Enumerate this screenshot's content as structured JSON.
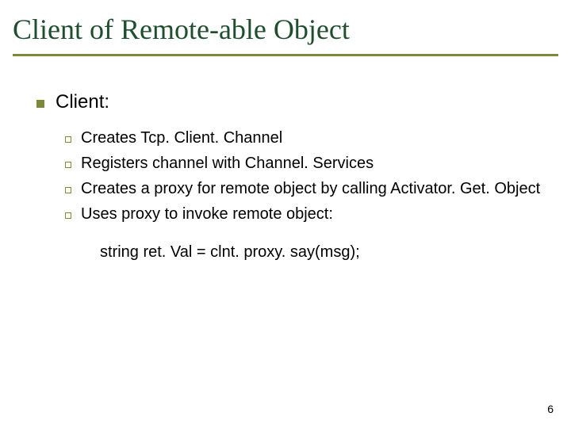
{
  "title": "Client of Remote-able Object",
  "l1_text": "Client:",
  "subitems": [
    "Creates Tcp. Client. Channel",
    "Registers channel with Channel. Services",
    "Creates a proxy for remote object by calling Activator. Get. Object",
    "Uses proxy to invoke remote object:"
  ],
  "code_line": "string ret. Val = clnt. proxy. say(msg);",
  "page_number": "6"
}
